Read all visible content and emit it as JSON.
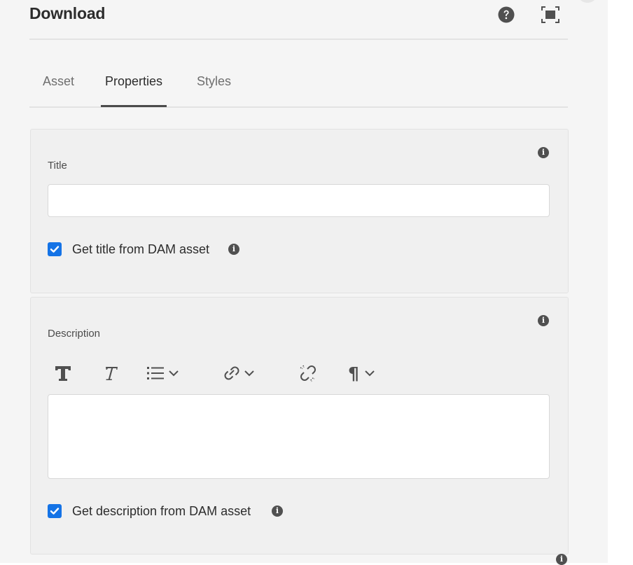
{
  "header": {
    "title": "Download"
  },
  "tabs": [
    {
      "label": "Asset"
    },
    {
      "label": "Properties"
    },
    {
      "label": "Styles"
    }
  ],
  "title_section": {
    "label": "Title",
    "value": "",
    "checkbox_label": "Get title from DAM asset",
    "checkbox_checked": true
  },
  "description_section": {
    "label": "Description",
    "value": "",
    "checkbox_label": "Get description from DAM asset",
    "checkbox_checked": true
  },
  "icons": {
    "info": "i",
    "paragraph": "¶"
  },
  "colors": {
    "accent": "#1473e6",
    "panel_bg": "#f5f5f5",
    "card_bg": "#f0f0f0"
  }
}
